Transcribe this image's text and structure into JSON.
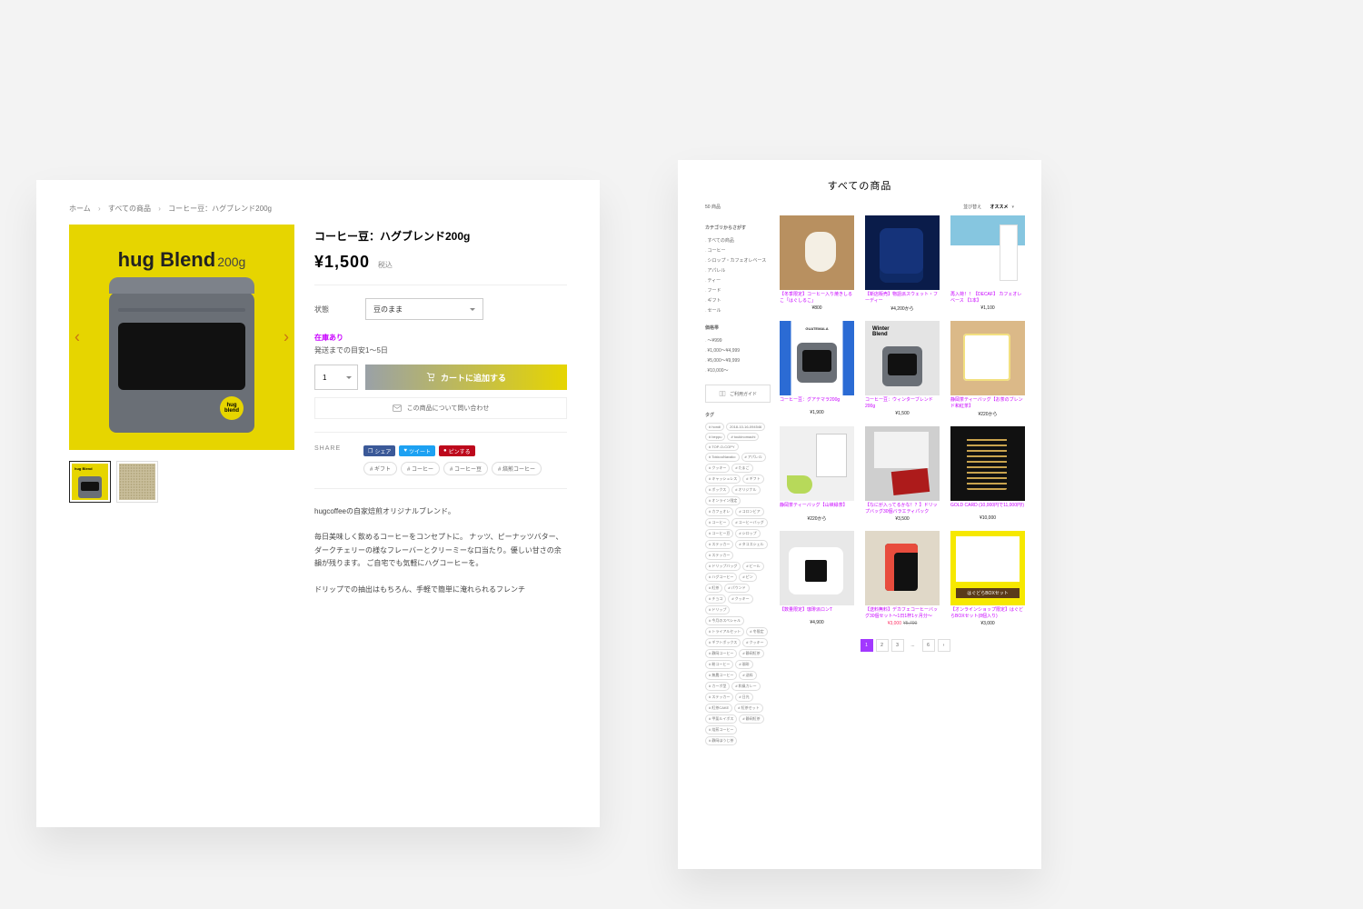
{
  "breadcrumbs": {
    "home": "ホーム",
    "all": "すべての商品",
    "current": "コーヒー豆：ハグブレンド200g"
  },
  "product": {
    "title": "コーヒー豆：ハグブレンド200g",
    "price": "¥1,500",
    "price_suffix": "税込",
    "state_label": "状態",
    "state_value": "豆のまま",
    "stock": "在庫あり",
    "leadtime": "発送までの目安1〜5日",
    "qty": "1",
    "cart_btn": "カートに追加する",
    "inquiry": "この商品について問い合わせ",
    "share_label": "SHARE",
    "share": {
      "fb": "シェア",
      "tw": "ツイート",
      "pn": "ピンする"
    },
    "tags": [
      "# ギフト",
      "# コーヒー",
      "# コーヒー豆",
      "# 焙煎コーヒー"
    ],
    "hero_caption": "hug Blend",
    "hero_sub": "200g",
    "desc": [
      "hugcoffeeの自家焙煎オリジナルブレンド。",
      "毎日美味しく飲めるコーヒーをコンセプトに。\nナッツ、ピーナッツバター、ダークチェリーの様なフレーバーとクリーミーな口当たり。優しい甘さの余韻が残ります。\nご自宅でも気軽にハグコーヒーを。",
      "ドリップでの抽出はもちろん、手軽で簡単に淹れられるフレンチ"
    ]
  },
  "list": {
    "heading": "すべての商品",
    "count": "50 商品",
    "sort_label": "並び替え",
    "sort_value": "オススメ",
    "side_cat_h": "カテゴリからさがす",
    "categories": [
      "すべての商品",
      "コーヒー",
      "シロップ・カフェオレベース",
      "アパレル",
      "ティー",
      "フード",
      "ギフト",
      "セール"
    ],
    "side_price_h": "価格帯",
    "price_ranges": [
      "〜¥999",
      "¥1,000〜¥4,999",
      "¥5,000〜¥9,999",
      "¥10,000〜"
    ],
    "guide_btn": "ご利用ガイド",
    "side_tag_h": "タグ",
    "tag_cloud": [
      "# hondi",
      "2018-10-16-094546",
      "# beppu",
      "# toukinomachi",
      "# TOP-O-COPY",
      "# TokkouNavako",
      "# アパレル",
      "# クッキー",
      "# たまご",
      "# キャッシュレス",
      "# ギフト",
      "# ボックス",
      "# オリジナル",
      "# オンライン限定",
      "# カフェオレ",
      "# コロンビア",
      "# コーヒー",
      "# コーヒーバッグ",
      "# コーヒー豆",
      "# シロップ",
      "# ステッカー",
      "# タコスシェル",
      "# ステッカー",
      "# ドリップバッグ",
      "# ビール",
      "# ハグコーヒー",
      "# ピン",
      "# 紅茶",
      "# パウンド",
      "# チョコ",
      "# クッキー",
      "# ドリップ",
      "# 今月のスペシャル",
      "# トライアルセット",
      "# 冬限定",
      "# ギフトボックス",
      "# クッキー",
      "# 静岡コーヒー",
      "# 静岡紅茶",
      "# 粉コーヒー",
      "# 珈琲",
      "# 無農コーヒー",
      "# 送料",
      "# カーボ型",
      "# 和風カレー",
      "# ステッカー",
      "# 日光",
      "# 紅茶CAKE ",
      "# 紅茶セット",
      "# 甲斐ルイボス",
      "# 静岡紅茶",
      "# 焙煎コーヒー",
      "# 静岡ほうじ茶"
    ],
    "products": [
      {
        "title": "【冬季限定】コーヒー入り焼きしるこ「はぐしるこ」",
        "price": "¥800"
      },
      {
        "title": "【新店販売】物語派スウェット・フーディー",
        "price": "¥4,200から"
      },
      {
        "title": "再入荷！！【DECAF】 カフェオレベース 【1本】",
        "price": "¥1,100"
      },
      {
        "title": "コーヒー豆：グアテマラ200g",
        "price": "¥1,900"
      },
      {
        "title": "コーヒー豆：ウィンターブレンド200g",
        "price": "¥1,500"
      },
      {
        "title": "静岡茶ティーバッグ【お茶のブレンド和紅茶】",
        "price": "¥220から"
      },
      {
        "title": "静岡茶ティーバッグ【山峡緑茶】",
        "price": "¥220から"
      },
      {
        "title": "【なにが入ってるかな！？】ドリップバッグ30個バラエティパック",
        "price": "¥3,500"
      },
      {
        "title": "GOLD CARD (10,000円で11,000円!)",
        "price": "¥10,000"
      },
      {
        "title": "【数量限定】珈琲派ロンT",
        "price": "¥4,900"
      },
      {
        "title": "【送料無料】デカフェコーヒーバッグ30個セット〜1日1杯1ヶ月分〜",
        "price": "",
        "sale": "¥3,000",
        "orig": "¥5,700"
      },
      {
        "title": "【オンラインショップ限定】はぐどらBOXセット(8個入り)",
        "price": "¥3,000"
      }
    ],
    "pages": [
      "1",
      "2",
      "3",
      "...",
      "6",
      "›"
    ],
    "page_current": 0
  }
}
